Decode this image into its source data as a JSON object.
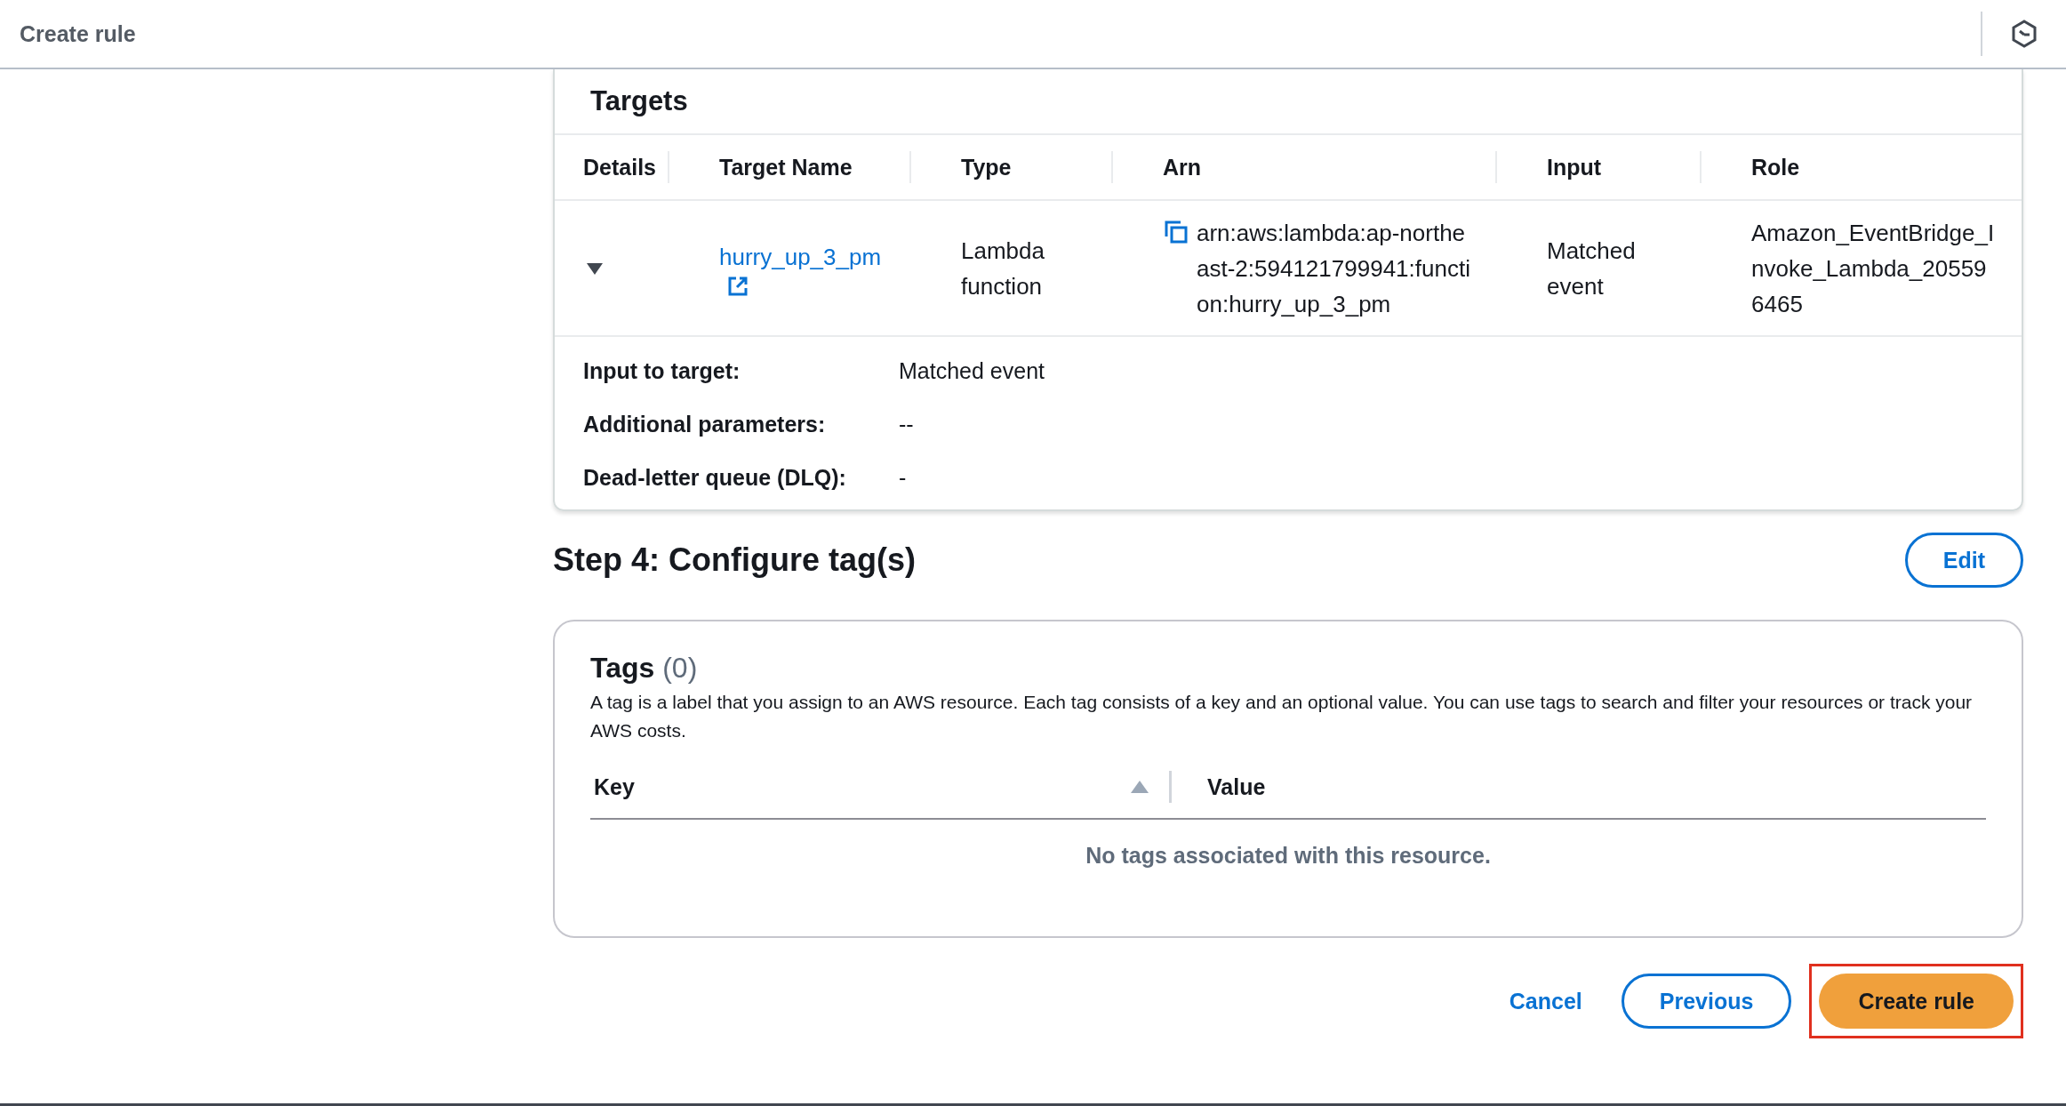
{
  "header": {
    "title": "Create rule"
  },
  "targets": {
    "title": "Targets",
    "columns": [
      "Details",
      "Target Name",
      "Type",
      "Arn",
      "Input",
      "Role"
    ],
    "rows": [
      {
        "expanded": true,
        "target_name": "hurry_up_3_pm",
        "type": "Lambda function",
        "arn": "arn:aws:lambda:ap-northeast-2:594121799941:function:hurry_up_3_pm",
        "input": "Matched event",
        "role": "Amazon_EventBridge_Invoke_Lambda_205596465",
        "details": [
          {
            "label": "Input to target:",
            "value": "Matched event"
          },
          {
            "label": "Additional parameters:",
            "value": "--"
          },
          {
            "label": "Dead-letter queue (DLQ):",
            "value": "-"
          }
        ]
      }
    ]
  },
  "step4": {
    "title": "Step 4: Configure tag(s)",
    "edit": "Edit",
    "tags": {
      "title": "Tags",
      "count": "(0)",
      "description": "A tag is a label that you assign to an AWS resource. Each tag consists of a key and an optional value. You can use tags to search and filter your resources or track your AWS costs.",
      "columns": [
        "Key",
        "Value"
      ],
      "empty": "No tags associated with this resource."
    }
  },
  "actions": [
    {
      "kind": "link",
      "label": "Cancel",
      "highlighted": false
    },
    {
      "kind": "secondary",
      "label": "Previous",
      "highlighted": false
    },
    {
      "kind": "primary",
      "label": "Create rule",
      "highlighted": true
    }
  ]
}
